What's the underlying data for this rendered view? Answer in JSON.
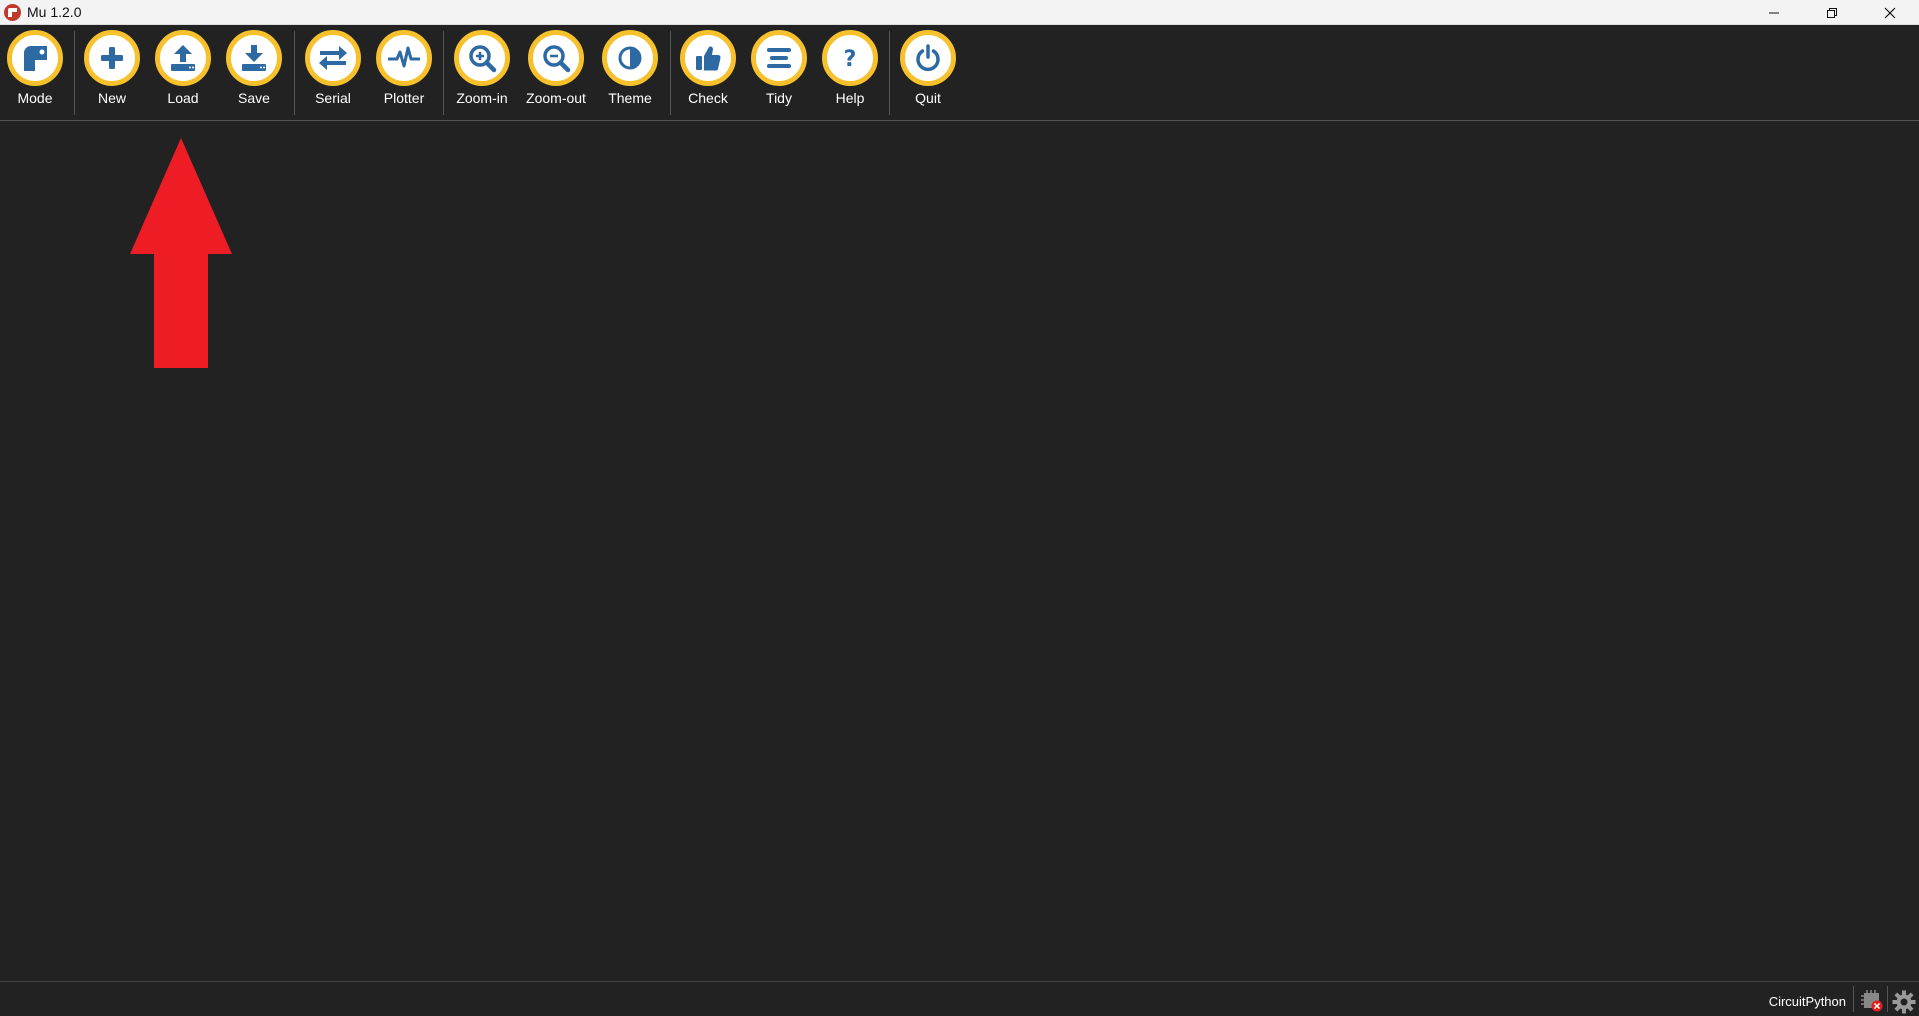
{
  "window": {
    "title": "Mu 1.2.0"
  },
  "toolbar": {
    "buttons": [
      {
        "id": "mode",
        "label": "Mode",
        "icon": "mode-icon"
      },
      {
        "id": "new",
        "label": "New",
        "icon": "plus-icon"
      },
      {
        "id": "load",
        "label": "Load",
        "icon": "upload-icon"
      },
      {
        "id": "save",
        "label": "Save",
        "icon": "download-icon"
      },
      {
        "id": "serial",
        "label": "Serial",
        "icon": "arrows-swap-icon"
      },
      {
        "id": "plotter",
        "label": "Plotter",
        "icon": "pulse-icon"
      },
      {
        "id": "zoom-in",
        "label": "Zoom-in",
        "icon": "zoom-in-icon"
      },
      {
        "id": "zoom-out",
        "label": "Zoom-out",
        "icon": "zoom-out-icon"
      },
      {
        "id": "theme",
        "label": "Theme",
        "icon": "contrast-icon"
      },
      {
        "id": "check",
        "label": "Check",
        "icon": "thumbs-up-icon"
      },
      {
        "id": "tidy",
        "label": "Tidy",
        "icon": "lines-icon"
      },
      {
        "id": "help",
        "label": "Help",
        "icon": "question-icon"
      },
      {
        "id": "quit",
        "label": "Quit",
        "icon": "power-icon"
      }
    ]
  },
  "status": {
    "mode": "CircuitPython",
    "device_icon": "chip-disconnected-icon",
    "settings_icon": "gear-icon"
  },
  "colors": {
    "background": "#222222",
    "button_ring": "#f6c12c",
    "icon_blue": "#2d6aa3",
    "annotation_arrow": "#ee1c25"
  }
}
